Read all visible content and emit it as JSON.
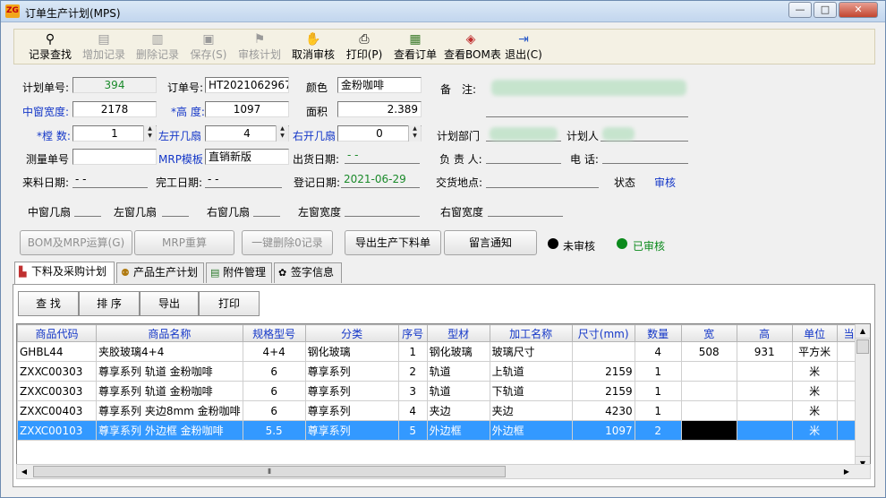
{
  "window": {
    "title": "订单生产计划(MPS)",
    "app_icon_text": "ZG"
  },
  "toolbar": {
    "find": "记录查找",
    "add": "增加记录",
    "delete": "删除记录",
    "save": "保存(S)",
    "audit": "审核计划",
    "cancel_audit": "取消审核",
    "print": "打印(P)",
    "view_order": "查看订单",
    "view_bom": "查看BOM表",
    "exit": "退出(C)"
  },
  "form": {
    "plan_no_label": "计划单号:",
    "plan_no": "394",
    "order_no_label": "订单号:",
    "order_no": "HT2021062967",
    "color_label": "颜色",
    "color": "金粉咖啡",
    "remark_label": "备　注:",
    "mid_width_label": "中窗宽度:",
    "mid_width": "2178",
    "height_label": "*高 度:",
    "height": "1097",
    "area_label": "面积",
    "area": "2.389",
    "tang_label": "*樘 数:",
    "tang": "1",
    "left_open_label": "左开几扇",
    "left_open": "4",
    "right_open_label": "右开几扇",
    "right_open": "0",
    "plan_dept_label": "计划部门",
    "planner_label": "计划人",
    "measure_no_label": "测量单号",
    "measure_no": "",
    "mrp_template_label": "MRP模板",
    "mrp_template": "直销新版",
    "ship_date_label": "出货日期:",
    "ship_date": " - -",
    "manager_label": "负 责 人:",
    "phone_label": "电 话:",
    "material_date_label": "来料日期:",
    "material_date": " - -",
    "finish_date_label": "完工日期:",
    "finish_date": " - -",
    "register_date_label": "登记日期:",
    "register_date": "2021-06-29",
    "delivery_label": "交货地点:",
    "status_label": "状态",
    "status": "审核",
    "mid_count_label": "中窗几扇",
    "left_count_label": "左窗几扇",
    "right_count_label": "右窗几扇",
    "left_width_label": "左窗宽度",
    "right_width_label": "右窗宽度"
  },
  "actions": {
    "bom_mrp": "BOM及MRP运算(G)",
    "mrp_recalc": "MRP重算",
    "delete_zero": "一键删除0记录",
    "export_list": "导出生产下料单",
    "message": "留言通知",
    "legend_unaudited": "未审核",
    "legend_audited": "已审核",
    "color_unaudited": "#000000",
    "color_audited": "#0b8a1c"
  },
  "tabs": [
    {
      "label": "下料及采购计划",
      "icon": "chart-icon"
    },
    {
      "label": "产品生产计划",
      "icon": "people-icon"
    },
    {
      "label": "附件管理",
      "icon": "attachment-icon"
    },
    {
      "label": "签字信息",
      "icon": "gear-icon"
    }
  ],
  "subtoolbar": {
    "find": "查 找",
    "sort": "排 序",
    "export": "导出",
    "print": "打印"
  },
  "table": {
    "headers": [
      "商品代码",
      "商品名称",
      "规格型号",
      "分类",
      "序号",
      "型材",
      "加工名称",
      "尺寸(mm)",
      "数量",
      "宽",
      "高",
      "单位",
      "当"
    ],
    "rows": [
      [
        "GHBL44",
        "夹胶玻璃4+4",
        "4+4",
        "钢化玻璃",
        "1",
        "钢化玻璃",
        "玻璃尺寸",
        "",
        "4",
        "508",
        "931",
        "平方米"
      ],
      [
        "ZXXC00303",
        "尊享系列 轨道 金粉咖啡",
        "6",
        "尊享系列",
        "2",
        "轨道",
        "上轨道",
        "2159",
        "1",
        "",
        "",
        "米"
      ],
      [
        "ZXXC00303",
        "尊享系列 轨道 金粉咖啡",
        "6",
        "尊享系列",
        "3",
        "轨道",
        "下轨道",
        "2159",
        "1",
        "",
        "",
        "米"
      ],
      [
        "ZXXC00403",
        "尊享系列 夹边8mm 金粉咖啡",
        "6",
        "尊享系列",
        "4",
        "夹边",
        "夹边",
        "4230",
        "1",
        "",
        "",
        "米"
      ],
      [
        "ZXXC00103",
        "尊享系列 外边框 金粉咖啡",
        "5.5",
        "尊享系列",
        "5",
        "外边框",
        "外边框",
        "1097",
        "2",
        "",
        "",
        "米"
      ]
    ]
  },
  "scroll": {
    "h_grip": "⦀"
  }
}
